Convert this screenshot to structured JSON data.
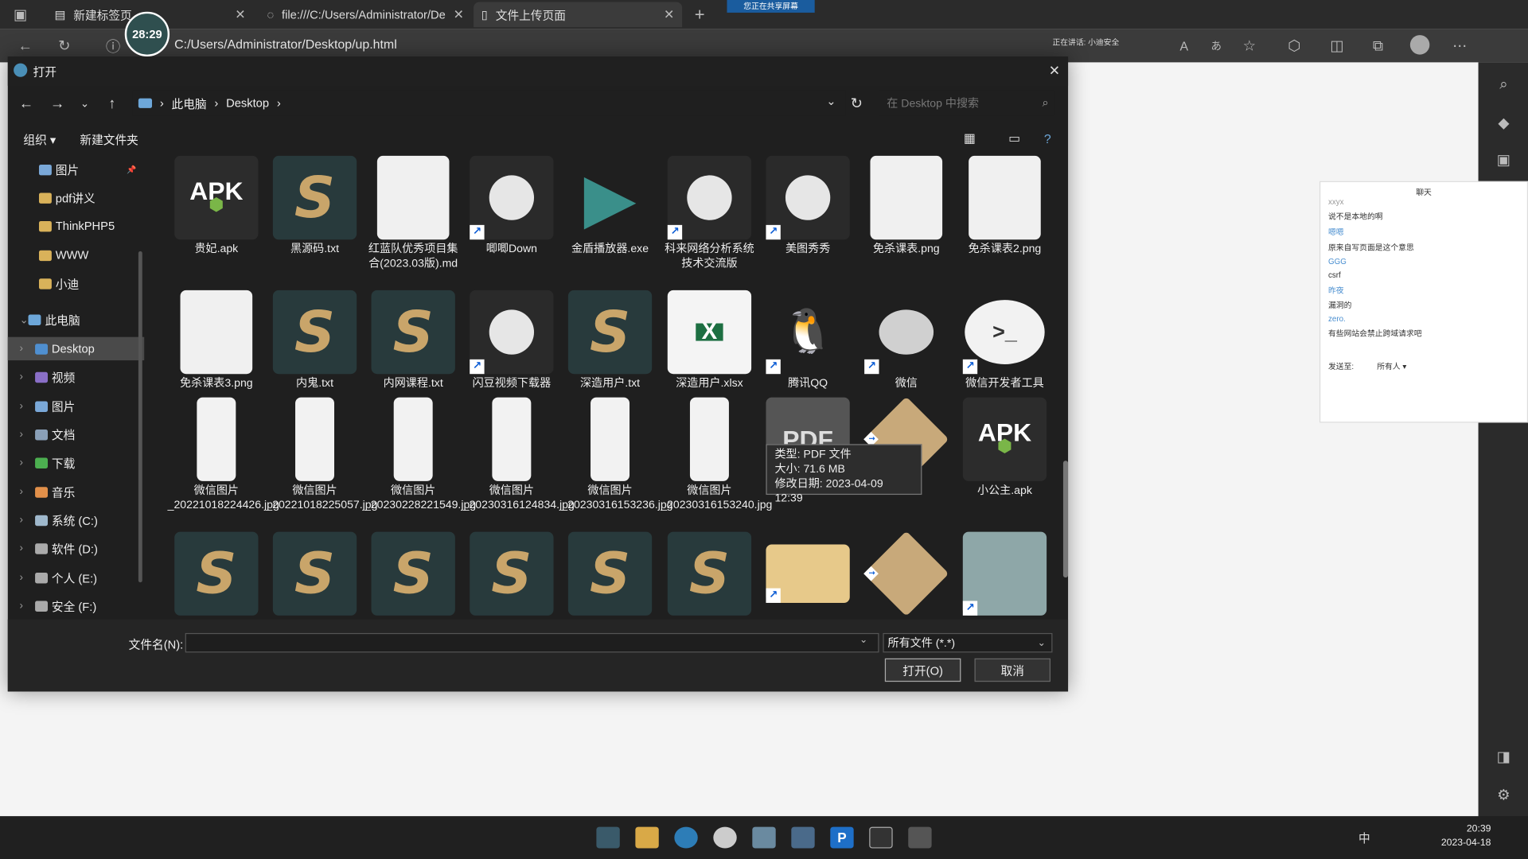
{
  "browser": {
    "tabs": [
      {
        "label": "新建标签页"
      },
      {
        "label": "file:///C:/Users/Administrator/De"
      },
      {
        "label": "文件上传页面"
      }
    ],
    "sharing_banner": "您正在共享屏幕",
    "url": "C:/Users/Administrator/Desktop/up.html",
    "speech_status": "正在讲话: 小迪安全",
    "timer": "28:29"
  },
  "dialog": {
    "title": "打开",
    "breadcrumb": [
      "此电脑",
      "Desktop"
    ],
    "search_placeholder": "在 Desktop 中搜索",
    "toolbar": {
      "organize": "组织 ▾",
      "new_folder": "新建文件夹"
    },
    "sidebar": [
      {
        "label": "图片",
        "color": "#7aa8d8"
      },
      {
        "label": "pdf讲义",
        "color": "#d9b25a"
      },
      {
        "label": "ThinkPHP5",
        "color": "#d9b25a"
      },
      {
        "label": "WWW",
        "color": "#d9b25a"
      },
      {
        "label": "小迪",
        "color": "#d9b25a"
      },
      {
        "label": "此电脑",
        "color": "#6da7d9"
      },
      {
        "label": "Desktop",
        "color": "#4f8fd0"
      },
      {
        "label": "视频",
        "color": "#8a6fc7"
      },
      {
        "label": "图片",
        "color": "#7aa8d8"
      },
      {
        "label": "文档",
        "color": "#8aa0b8"
      },
      {
        "label": "下载",
        "color": "#4caf50"
      },
      {
        "label": "音乐",
        "color": "#e2904a"
      },
      {
        "label": "系统 (C:)",
        "color": "#9fb8cc"
      },
      {
        "label": "软件 (D:)",
        "color": "#aaaaaa"
      },
      {
        "label": "个人 (E:)",
        "color": "#aaaaaa"
      },
      {
        "label": "安全 (F:)",
        "color": "#aaaaaa"
      }
    ],
    "files": [
      {
        "name": "贵妃.apk",
        "type": "apk"
      },
      {
        "name": "黑源码.txt",
        "type": "sublime"
      },
      {
        "name": "红蓝队优秀项目集合(2023.03版).md",
        "type": "doc"
      },
      {
        "name": "唧唧Down",
        "type": "app"
      },
      {
        "name": "金盾播放器.exe",
        "type": "play"
      },
      {
        "name": "科来网络分析系统 技术交流版",
        "type": "app"
      },
      {
        "name": "美图秀秀",
        "type": "app"
      },
      {
        "name": "免杀课表.png",
        "type": "doc"
      },
      {
        "name": "免杀课表2.png",
        "type": "doc"
      },
      {
        "name": "免杀课表3.png",
        "type": "doc"
      },
      {
        "name": "内鬼.txt",
        "type": "sublime"
      },
      {
        "name": "内网课程.txt",
        "type": "sublime"
      },
      {
        "name": "闪豆视频下载器",
        "type": "app"
      },
      {
        "name": "深造用户.txt",
        "type": "sublime"
      },
      {
        "name": "深造用户.xlsx",
        "type": "xlsx"
      },
      {
        "name": "腾讯QQ",
        "type": "qq"
      },
      {
        "name": "微信",
        "type": "wechat"
      },
      {
        "name": "微信开发者工具",
        "type": "wxdev"
      },
      {
        "name": "微信图片_20221018224426.jpg",
        "type": "phone"
      },
      {
        "name": "微信图片_20221018225057.jpg",
        "type": "phone"
      },
      {
        "name": "微信图片_20230228221549.jpg",
        "type": "phone"
      },
      {
        "name": "微信图片_20230316124834.jpg",
        "type": "phone"
      },
      {
        "name": "微信图片_20230316153236.jpg",
        "type": "phone"
      },
      {
        "name": "微信图片_20230316153240.jpg",
        "type": "phone"
      },
      {
        "name": "",
        "type": "pdf"
      },
      {
        "name": "",
        "type": "shape"
      },
      {
        "name": "小公主.apk",
        "type": "apk"
      },
      {
        "name": "",
        "type": "sublime"
      },
      {
        "name": "",
        "type": "sublime"
      },
      {
        "name": "",
        "type": "sublime"
      },
      {
        "name": "",
        "type": "sublime"
      },
      {
        "name": "",
        "type": "sublime"
      },
      {
        "name": "",
        "type": "sublime"
      },
      {
        "name": "",
        "type": "folder"
      },
      {
        "name": "",
        "type": "shape"
      },
      {
        "name": "",
        "type": "monitor"
      }
    ],
    "tooltip": {
      "type": "类型: PDF 文件",
      "size": "大小: 71.6 MB",
      "date": "修改日期: 2023-04-09 12:39"
    },
    "filename_label": "文件名(N):",
    "filename_value": "",
    "filter": "所有文件 (*.*)",
    "open_button": "打开(O)",
    "cancel_button": "取消"
  },
  "chat": {
    "title": "聊天",
    "lines": [
      "xxyx",
      "说不是本地的啊",
      "嗯嗯",
      "原来自写页面是这个意思",
      "GGG",
      "csrf",
      "昨夜",
      "漏洞的",
      "zero.",
      "有些网站会禁止跨域请求吧"
    ],
    "footer_label": "发送至:",
    "footer_value": "所有人 ▾"
  },
  "taskbar": {
    "time": "20:39",
    "date": "2023-04-18",
    "ime": "中"
  }
}
